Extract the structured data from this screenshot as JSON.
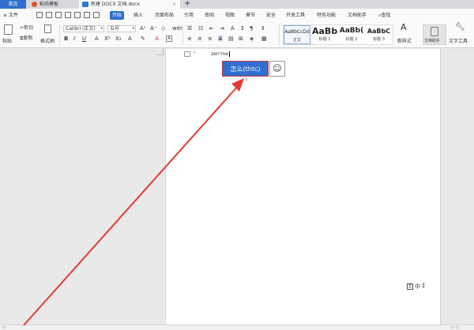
{
  "tabs": {
    "home": "首页",
    "template": "稻壳模板",
    "document": "新建 DOCX 文档.docx",
    "add": "+"
  },
  "menu": {
    "file": "≡ 文件",
    "items": [
      "开始",
      "插入",
      "页面布局",
      "引用",
      "审阅",
      "视图",
      "章节",
      "安全",
      "开发工具",
      "特色功能",
      "文档助手"
    ],
    "search": "查找"
  },
  "ribbon": {
    "paste": "粘贴",
    "cut": "剪切",
    "copy": "复制",
    "format_painter": "格式刷",
    "font_name": "Calibri (正文)",
    "font_size": "五号",
    "styles": [
      {
        "preview": "AaBbCcDd",
        "label": "正文"
      },
      {
        "preview": "AaBb",
        "label": "标题 1"
      },
      {
        "preview": "AaBb(",
        "label": "标题 2"
      },
      {
        "preview": "AaBbC",
        "label": "标题 3"
      }
    ],
    "new_style": "新样式",
    "doc_assistant": "文档助手",
    "text_tools": "文字工具"
  },
  "document": {
    "typed_text": "zen'me",
    "candidate": "怎么(thtc)",
    "emoji": "☺",
    "ime_mode_box": "五",
    "ime_mode_text": "中",
    "ime_mode_extra": "⁑"
  },
  "colors": {
    "accent": "#2f6fcf",
    "annotation": "#e53935"
  }
}
